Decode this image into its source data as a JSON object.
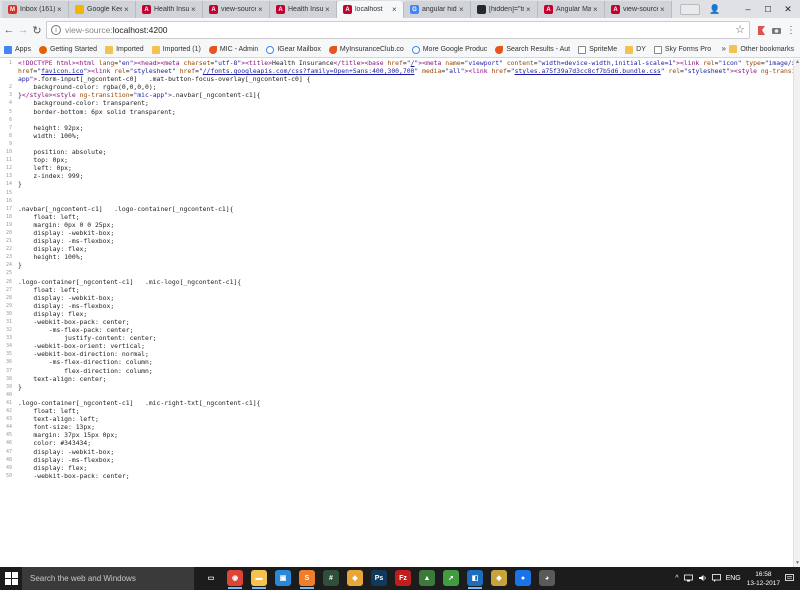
{
  "tabs": [
    {
      "title": "Inbox (161) -",
      "icon": "gmail-icon",
      "color": "#d93025",
      "glyph": "M"
    },
    {
      "title": "Google Keep",
      "icon": "keep-icon",
      "color": "#f4b400",
      "glyph": ""
    },
    {
      "title": "Health Insuran",
      "icon": "angular-icon",
      "color": "#c3002f",
      "glyph": "A"
    },
    {
      "title": "view-source:",
      "icon": "angular-icon",
      "color": "#c3002f",
      "glyph": "A"
    },
    {
      "title": "Health Insuran",
      "icon": "angular-icon",
      "color": "#c3002f",
      "glyph": "A"
    },
    {
      "title": "localhost",
      "icon": "angular-icon",
      "color": "#c3002f",
      "glyph": "A",
      "active": true
    },
    {
      "title": "angular hide",
      "icon": "google-icon",
      "color": "#4285f4",
      "glyph": "G"
    },
    {
      "title": "[hidden]=\"tru",
      "icon": "github-icon",
      "color": "#24292e",
      "glyph": ""
    },
    {
      "title": "Angular Mate",
      "icon": "angular-icon",
      "color": "#c3002f",
      "glyph": "A"
    },
    {
      "title": "view-source:l",
      "icon": "angular-icon",
      "color": "#c3002f",
      "glyph": "A"
    }
  ],
  "toolbar": {
    "back": "←",
    "forward": "→",
    "reload": "↻",
    "url_scheme": "view-source:",
    "url_host": "localhost:4200",
    "star": "☆"
  },
  "window": {
    "minimize": "–",
    "maximize": "☐",
    "close": "✕",
    "profile": "👤"
  },
  "bookmarks": [
    {
      "label": "Apps",
      "kind": "apps"
    },
    {
      "label": "Getting Started",
      "kind": "firefox"
    },
    {
      "label": "Imported",
      "kind": "folder"
    },
    {
      "label": "Imported (1)",
      "kind": "folder"
    },
    {
      "label": "MIC - Admin",
      "kind": "arrow"
    },
    {
      "label": "IGear Mailbox",
      "kind": "google"
    },
    {
      "label": "MyInsuranceClub.co",
      "kind": "arrow"
    },
    {
      "label": "More Google Produc",
      "kind": "google"
    },
    {
      "label": "Search Results - Aut",
      "kind": "arrow"
    },
    {
      "label": "SpriteMe",
      "kind": "page"
    },
    {
      "label": "DY",
      "kind": "folder"
    },
    {
      "label": "Sky Forms Pro",
      "kind": "page"
    }
  ],
  "bookmarks_more": "»",
  "bookmarks_other": "Other bookmarks",
  "source_lines": [
    {
      "n": "1",
      "html": "<span class='tag'>&lt;!DOCTYPE html&gt;&lt;html</span> <span class='attr'>lang</span>=<span class='val'>\"en\"</span><span class='tag'>&gt;&lt;head&gt;&lt;meta</span> <span class='attr'>charset</span>=<span class='val'>\"utf-8\"</span><span class='tag'>&gt;&lt;title&gt;</span>Health Insurance<span class='tag'>&lt;/title&gt;&lt;base</span> <span class='attr'>href</span>=<span class='val'>\"<span class='lnk'>/</span>\"</span><span class='tag'>&gt;&lt;meta</span> <span class='attr'>name</span>=<span class='val'>\"viewport\"</span> <span class='attr'>content</span>=<span class='val'>\"width=device-width,initial-scale=1\"</span><span class='tag'>&gt;&lt;link</span> <span class='attr'>rel</span>=<span class='val'>\"icon\"</span> <span class='attr'>type</span>=<span class='val'>\"image/x-icon\"</span>"
    },
    {
      "n": "",
      "html": "<span class='attr'>href</span>=<span class='val'>\"<span class='lnk'>favicon.ico</span>\"</span><span class='tag'>&gt;&lt;link</span> <span class='attr'>rel</span>=<span class='val'>\"stylesheet\"</span> <span class='attr'>href</span>=<span class='val'>\"<span class='lnk'>//fonts.googleapis.com/css?family=Open+Sans:400,300,700</span>\"</span> <span class='attr'>media</span>=<span class='val'>\"all\"</span><span class='tag'>&gt;&lt;link</span> <span class='attr'>href</span>=<span class='val'>\"<span class='lnk'>styles.a75f39a7d3cc8cf7b5d6.bundle.css</span>\"</span> <span class='attr'>rel</span>=<span class='val'>\"stylesheet\"</span><span class='tag'>&gt;&lt;style</span> <span class='attr'>ng-transition</span>=<span class='val'>\"mic-</span>"
    },
    {
      "n": "",
      "html": "<span class='val'>app\"</span><span class='tag'>&gt;</span>.form-input[_ngcontent-c0]   .mat-button-focus-overlay[_ngcontent-c0] {"
    },
    {
      "n": "2",
      "html": "    background-color: rgba(0,0,0,0);"
    },
    {
      "n": "3",
      "html": "}<span class='tag'>&lt;/style&gt;&lt;style</span> <span class='attr'>ng-transition</span>=<span class='val'>\"mic-app\"</span><span class='tag'>&gt;</span>.navbar[_ngcontent-c1]{"
    },
    {
      "n": "4",
      "html": "    background-color: transparent;"
    },
    {
      "n": "5",
      "html": "    border-bottom: 6px solid transparent;"
    },
    {
      "n": "6",
      "html": ""
    },
    {
      "n": "7",
      "html": "    height: 92px;"
    },
    {
      "n": "8",
      "html": "    width: 100%;"
    },
    {
      "n": "9",
      "html": ""
    },
    {
      "n": "10",
      "html": "    position: absolute;"
    },
    {
      "n": "11",
      "html": "    top: 0px;"
    },
    {
      "n": "12",
      "html": "    left: 0px;"
    },
    {
      "n": "13",
      "html": "    z-index: 999;"
    },
    {
      "n": "14",
      "html": "}"
    },
    {
      "n": "15",
      "html": ""
    },
    {
      "n": "16",
      "html": ""
    },
    {
      "n": "17",
      "html": ".navbar[_ngcontent-c1]   .logo-container[_ngcontent-c1]{"
    },
    {
      "n": "18",
      "html": "    float: left;"
    },
    {
      "n": "19",
      "html": "    margin: 0px 0 0 25px;"
    },
    {
      "n": "20",
      "html": "    display: -webkit-box;"
    },
    {
      "n": "21",
      "html": "    display: -ms-flexbox;"
    },
    {
      "n": "22",
      "html": "    display: flex;"
    },
    {
      "n": "23",
      "html": "    height: 100%;"
    },
    {
      "n": "24",
      "html": "}"
    },
    {
      "n": "25",
      "html": ""
    },
    {
      "n": "26",
      "html": ".logo-container[_ngcontent-c1]   .mic-logo[_ngcontent-c1]{"
    },
    {
      "n": "27",
      "html": "    float: left;"
    },
    {
      "n": "28",
      "html": "    display: -webkit-box;"
    },
    {
      "n": "29",
      "html": "    display: -ms-flexbox;"
    },
    {
      "n": "30",
      "html": "    display: flex;"
    },
    {
      "n": "31",
      "html": "    -webkit-box-pack: center;"
    },
    {
      "n": "32",
      "html": "        -ms-flex-pack: center;"
    },
    {
      "n": "33",
      "html": "            justify-content: center;"
    },
    {
      "n": "34",
      "html": "    -webkit-box-orient: vertical;"
    },
    {
      "n": "35",
      "html": "    -webkit-box-direction: normal;"
    },
    {
      "n": "36",
      "html": "        -ms-flex-direction: column;"
    },
    {
      "n": "37",
      "html": "            flex-direction: column;"
    },
    {
      "n": "38",
      "html": "    text-align: center;"
    },
    {
      "n": "39",
      "html": "}"
    },
    {
      "n": "40",
      "html": ""
    },
    {
      "n": "41",
      "html": ".logo-container[_ngcontent-c1]   .mic-right-txt[_ngcontent-c1]{"
    },
    {
      "n": "42",
      "html": "    float: left;"
    },
    {
      "n": "43",
      "html": "    text-align: left;"
    },
    {
      "n": "44",
      "html": "    font-size: 13px;"
    },
    {
      "n": "45",
      "html": "    margin: 37px 15px 0px;"
    },
    {
      "n": "46",
      "html": "    color: #343434;"
    },
    {
      "n": "47",
      "html": "    display: -webkit-box;"
    },
    {
      "n": "48",
      "html": "    display: -ms-flexbox;"
    },
    {
      "n": "49",
      "html": "    display: flex;"
    },
    {
      "n": "50",
      "html": "    -webkit-box-pack: center;"
    }
  ],
  "taskbar": {
    "search_placeholder": "Search the web and Windows",
    "apps": [
      {
        "name": "task-view-icon",
        "color": "#1c1c1c",
        "glyph": "▭"
      },
      {
        "name": "chrome-icon",
        "color": "#db4437",
        "glyph": "◉",
        "running": true
      },
      {
        "name": "file-explorer-icon",
        "color": "#f3c24f",
        "glyph": "▬",
        "running": true
      },
      {
        "name": "store-icon",
        "color": "#2b88d8",
        "glyph": "▣"
      },
      {
        "name": "sublime-icon",
        "color": "#f07d2b",
        "glyph": "S",
        "running": true
      },
      {
        "name": "slack-icon",
        "color": "#2f4f3a",
        "glyph": "#"
      },
      {
        "name": "chrome-dev-icon",
        "color": "#e8a53a",
        "glyph": "◆"
      },
      {
        "name": "photoshop-icon",
        "color": "#0f3a5c",
        "glyph": "Ps"
      },
      {
        "name": "filezilla-icon",
        "color": "#bf1e1e",
        "glyph": "Fz"
      },
      {
        "name": "terminal-icon",
        "color": "#3b7a3b",
        "glyph": "▲"
      },
      {
        "name": "maps-icon",
        "color": "#3f9c3f",
        "glyph": "➚"
      },
      {
        "name": "vscode-icon",
        "color": "#1c6dbc",
        "glyph": "◧",
        "running": true
      },
      {
        "name": "paint-icon",
        "color": "#c8a23a",
        "glyph": "◆"
      },
      {
        "name": "location-icon",
        "color": "#1a73e8",
        "glyph": "●"
      },
      {
        "name": "app-icon",
        "color": "#5a5a5a",
        "glyph": "◕"
      }
    ],
    "tray_up": "^",
    "language": "ENG",
    "time": "16:58",
    "date": "13-12-2017"
  }
}
